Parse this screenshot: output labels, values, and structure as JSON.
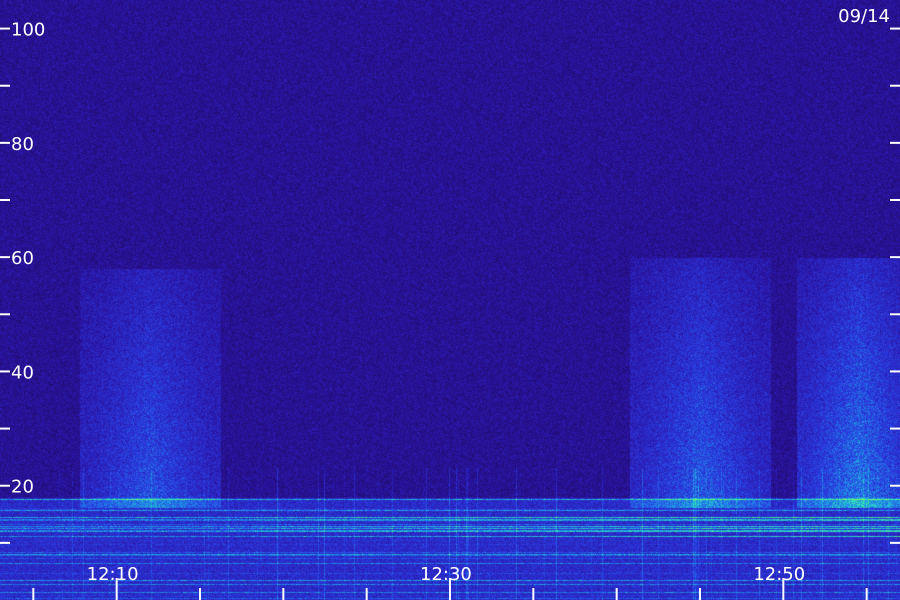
{
  "date_label": "09/14",
  "chart_data": {
    "type": "heatmap",
    "title": "",
    "xlabel": "",
    "ylabel": "",
    "x_range": [
      "12:03",
      "12:57"
    ],
    "ylim": [
      0,
      105
    ],
    "y_tick_labels": [
      "20",
      "40",
      "60",
      "80",
      "100"
    ],
    "y_ticks_minor": [
      10,
      30,
      50,
      70,
      90
    ],
    "x_tick_labels": [
      "12:10",
      "12:30",
      "12:50"
    ],
    "x_ticks_minor": [
      "12:05",
      "12:15",
      "12:20",
      "12:25",
      "12:35",
      "12:40",
      "12:45",
      "12:55"
    ],
    "colormap": [
      "#1b0a4a",
      "#2a12a0",
      "#2a3ae0",
      "#1f8fe8",
      "#2ee0c0",
      "#7cff5a"
    ],
    "emission_bursts": [
      {
        "start": "12:09",
        "end": "12:15",
        "freq_low": 18,
        "freq_high": 58,
        "intensity": 0.55
      },
      {
        "start": "12:42",
        "end": "12:48",
        "freq_low": 18,
        "freq_high": 60,
        "intensity": 0.6
      },
      {
        "start": "12:52",
        "end": "12:57",
        "freq_low": 18,
        "freq_high": 60,
        "intensity": 0.75
      }
    ],
    "low_band": {
      "freq_low": 0,
      "freq_high": 18,
      "intensity": 0.85
    },
    "grid": false,
    "legend": "none"
  }
}
